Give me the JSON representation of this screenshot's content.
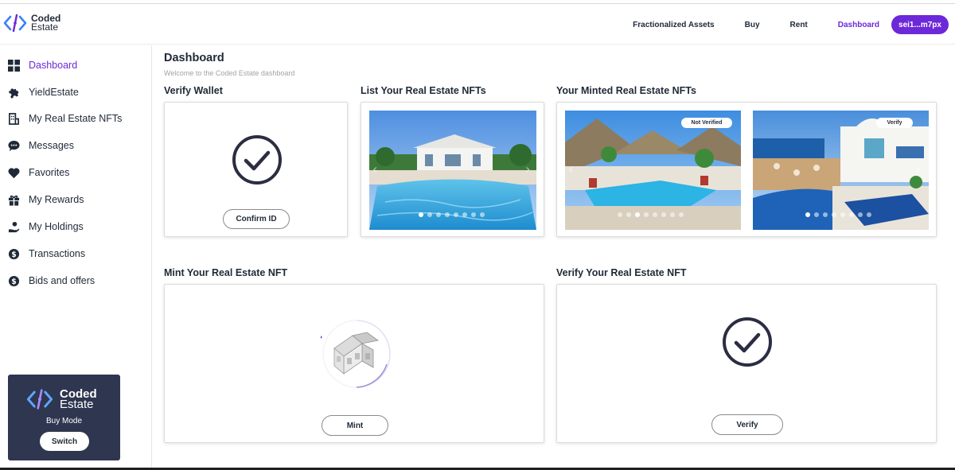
{
  "brand": {
    "line1": "Coded",
    "line2": "Estate"
  },
  "nav": {
    "items": [
      "Fractionalized Assets",
      "Buy",
      "Rent",
      "Dashboard"
    ],
    "active": "Dashboard",
    "wallet": "sei1...m7px"
  },
  "sidebar": {
    "items": [
      {
        "label": "Dashboard",
        "icon": "grid-icon"
      },
      {
        "label": "YieldEstate",
        "icon": "puzzle-icon"
      },
      {
        "label": "My Real Estate NFTs",
        "icon": "building-icon"
      },
      {
        "label": "Messages",
        "icon": "chat-icon"
      },
      {
        "label": "Favorites",
        "icon": "heart-icon"
      },
      {
        "label": "My Rewards",
        "icon": "gift-icon"
      },
      {
        "label": "My Holdings",
        "icon": "hand-coin-icon"
      },
      {
        "label": "Transactions",
        "icon": "dollar-circle-icon"
      },
      {
        "label": "Bids and offers",
        "icon": "dollar-circle-icon"
      }
    ],
    "mode_card": {
      "brand1": "Coded",
      "brand2": "Estate",
      "mode": "Buy Mode",
      "button": "Switch"
    }
  },
  "main": {
    "title": "Dashboard",
    "subtitle": "Welcome to the Coded Estate dashboard",
    "verify_wallet": {
      "title": "Verify Wallet",
      "button": "Confirm ID"
    },
    "list_nfts": {
      "title": "List Your Real Estate NFTs"
    },
    "minted_nfts": {
      "title": "Your Minted Real Estate NFTs",
      "badges": [
        "Not Verified",
        "Verify"
      ]
    },
    "mint": {
      "title": "Mint Your Real Estate NFT",
      "button": "Mint"
    },
    "verify_nft": {
      "title": "Verify Your Real Estate NFT",
      "button": "Verify"
    }
  },
  "colors": {
    "accent": "#6d28d9",
    "dark": "#2b2d42",
    "mode_card_bg": "#2f3650"
  }
}
